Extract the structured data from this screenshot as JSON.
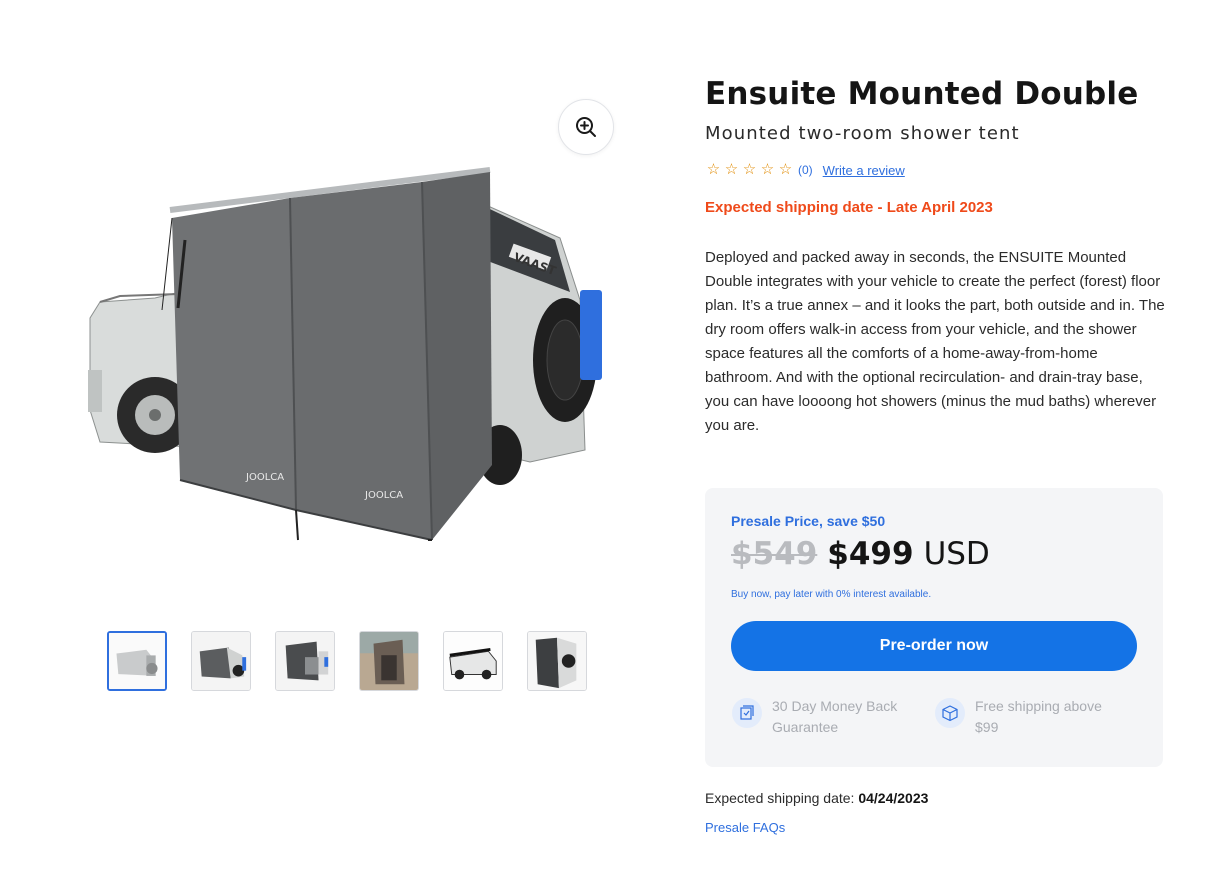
{
  "product": {
    "title": "Ensuite Mounted Double",
    "subtitle": "Mounted two-room shower tent",
    "review_count": "(0)",
    "write_review": "Write a review",
    "shipping_note": "Expected shipping date - Late April 2023",
    "description": "Deployed and packed away in seconds, the ENSUITE Mounted Double integrates with your vehicle to create the perfect (forest) floor plan. It’s a true annex – and it looks the part, both outside and in. The dry room offers walk-in access from your vehicle, and the shower space features all the comforts of a home-away-from-home bathroom. And with the optional recirculation- and drain-tray base, you can have loooong hot showers (minus the mud baths) wherever you are.",
    "stars": [
      "☆",
      "☆",
      "☆",
      "☆",
      "☆"
    ]
  },
  "gallery": {
    "tent_brand": "JOOLCA",
    "vehicle_text": "VAAST",
    "thumbnail_count": 6,
    "active_thumbnail": 1
  },
  "pricing": {
    "presale_label": "Presale Price, save $50",
    "old_price": "$549",
    "new_price": "$499",
    "currency": "USD",
    "paylater": "Buy now, pay later with 0% interest available.",
    "preorder_button": "Pre-order now",
    "perks": [
      {
        "icon": "money-back-icon",
        "text": "30 Day Money Back Guarantee"
      },
      {
        "icon": "shipping-box-icon",
        "text": "Free shipping above $99"
      }
    ]
  },
  "footer": {
    "expected_label": "Expected shipping date:",
    "expected_date": "04/24/2023",
    "faqs": "Presale FAQs"
  },
  "colors": {
    "accent": "#1473e6",
    "link": "#2f6fde",
    "warning": "#ef4a1a",
    "star": "#e08a00",
    "card_bg": "#f4f5f7"
  }
}
